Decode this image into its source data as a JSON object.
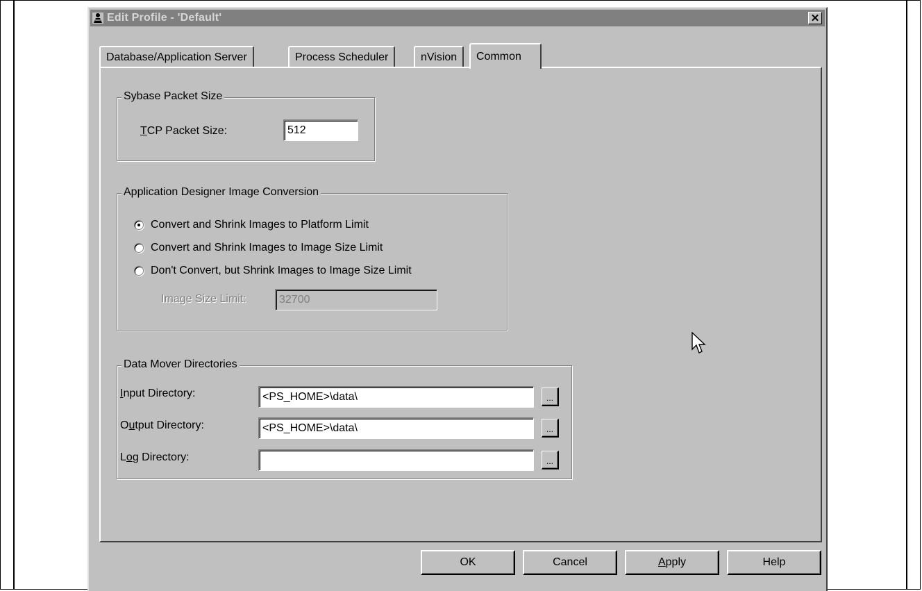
{
  "window": {
    "title": "Edit Profile - 'Default'",
    "close_symbol": "✕"
  },
  "tabs": [
    {
      "label": "Database/Application Server",
      "active": false
    },
    {
      "label": "Process Scheduler",
      "active": false
    },
    {
      "label": "nVision",
      "active": false
    },
    {
      "label": "Common",
      "active": true
    }
  ],
  "sybase": {
    "group_title": "Sybase Packet Size",
    "label_mnemonic": "T",
    "label_rest": "CP Packet Size:",
    "value": "512"
  },
  "image_conversion": {
    "group_title": "Application Designer Image Conversion",
    "options": [
      {
        "label": "Convert and Shrink Images to Platform Limit",
        "selected": true
      },
      {
        "label": "Convert and Shrink Images to Image Size Limit",
        "selected": false
      },
      {
        "label": "Don't Convert, but Shrink Images to Image Size Limit",
        "selected": false
      }
    ],
    "limit_label": "Image Size Limit:",
    "limit_value": "32700"
  },
  "data_mover": {
    "group_title": "Data Mover Directories",
    "rows": [
      {
        "pre": "",
        "mnemonic": "I",
        "post": "nput Directory:",
        "value": "<PS_HOME>\\data\\"
      },
      {
        "pre": "O",
        "mnemonic": "u",
        "post": "tput Directory:",
        "value": "<PS_HOME>\\data\\"
      },
      {
        "pre": "L",
        "mnemonic": "o",
        "post": "g Directory:",
        "value": ""
      }
    ],
    "browse_label": "..."
  },
  "buttons": {
    "ok": "OK",
    "cancel": "Cancel",
    "apply_mnemonic": "A",
    "apply_rest": "pply",
    "help": "Help"
  },
  "colors": {
    "dialog_face": "#c0c0c0",
    "inactive_titlebar": "#808080"
  },
  "icons": {
    "app": "peoplesoft-icon",
    "close": "close-icon",
    "browse": "ellipsis-icon",
    "cursor": "mouse-pointer-icon"
  }
}
